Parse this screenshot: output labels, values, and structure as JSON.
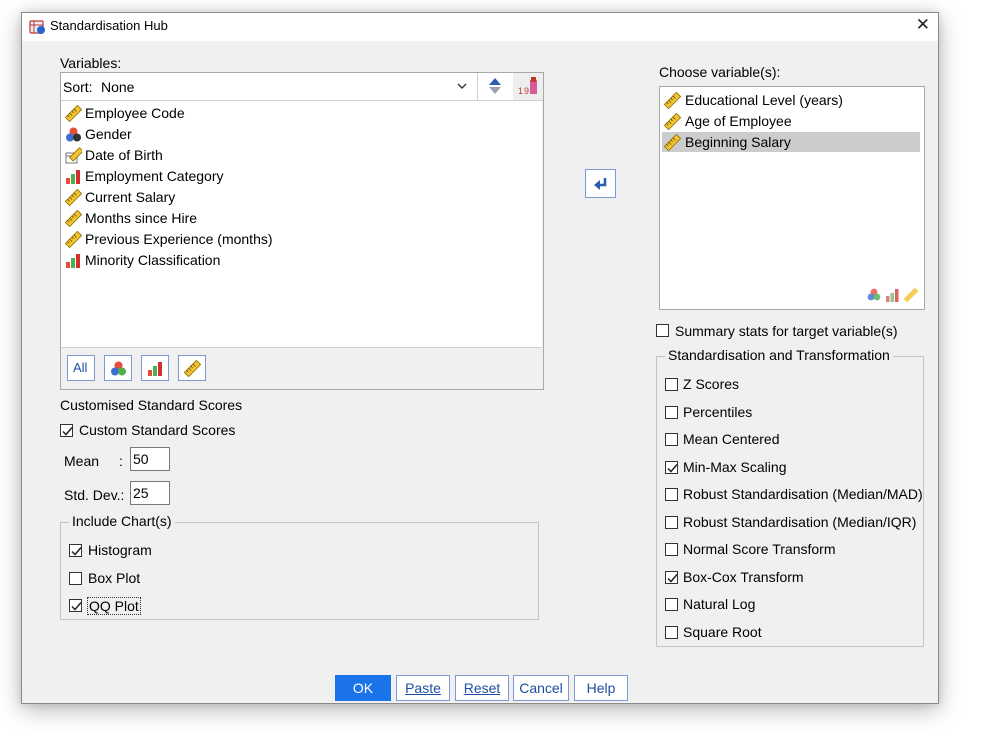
{
  "window": {
    "title": "Standardisation Hub",
    "close_glyph": "✕"
  },
  "variables_panel": {
    "label": "Variables:",
    "sort_label": "Sort:",
    "sort_value": "None",
    "items": [
      {
        "label": "Employee Code",
        "icon": "ruler-icon"
      },
      {
        "label": "Gender",
        "icon": "nominal-icon"
      },
      {
        "label": "Date of Birth",
        "icon": "date-ruler-icon"
      },
      {
        "label": "Employment Category",
        "icon": "ordinal-bar-icon"
      },
      {
        "label": "Current Salary",
        "icon": "ruler-icon"
      },
      {
        "label": "Months since Hire",
        "icon": "ruler-icon"
      },
      {
        "label": "Previous Experience (months)",
        "icon": "ruler-icon"
      },
      {
        "label": "Minority Classification",
        "icon": "ordinal-bar-icon"
      }
    ],
    "filter_all_label": "All"
  },
  "target_panel": {
    "label": "Choose variable(s):",
    "items": [
      {
        "label": "Educational Level (years)",
        "icon": "ruler-icon",
        "selected": false
      },
      {
        "label": "Age of  Employee",
        "icon": "ruler-icon",
        "selected": false
      },
      {
        "label": "Beginning Salary",
        "icon": "ruler-icon",
        "selected": true
      }
    ]
  },
  "summary_stats": {
    "label": "Summary stats for target variable(s)",
    "checked": false
  },
  "transform_group": {
    "legend": "Standardisation and Transformation",
    "options": [
      {
        "label": "Z Scores",
        "checked": false
      },
      {
        "label": "Percentiles",
        "checked": false
      },
      {
        "label": "Mean Centered",
        "checked": false
      },
      {
        "label": "Min-Max Scaling",
        "checked": true
      },
      {
        "label": "Robust Standardisation (Median/MAD)",
        "checked": false
      },
      {
        "label": "Robust Standardisation (Median/IQR)",
        "checked": false
      },
      {
        "label": "Normal Score Transform",
        "checked": false
      },
      {
        "label": "Box-Cox Transform",
        "checked": true
      },
      {
        "label": "Natural Log",
        "checked": false
      },
      {
        "label": "Square Root",
        "checked": false
      }
    ]
  },
  "custom_scores": {
    "section_label": "Customised Standard Scores",
    "checkbox_label": "Custom Standard Scores",
    "checked": true,
    "mean_label": "Mean",
    "mean_colon": ":",
    "mean_value": "50",
    "sd_label": "Std. Dev.:",
    "sd_value": "25"
  },
  "charts_group": {
    "legend": "Include Chart(s)",
    "options": [
      {
        "label": "Histogram",
        "checked": true
      },
      {
        "label": "Box Plot",
        "checked": false
      },
      {
        "label": "QQ Plot",
        "checked": true
      }
    ]
  },
  "buttons": {
    "ok": "OK",
    "paste": "Paste",
    "reset": "Reset",
    "cancel": "Cancel",
    "help": "Help"
  },
  "colors": {
    "accent": "#1a73e8",
    "button_border": "#7c9bd4",
    "selection": "#cccccc"
  }
}
